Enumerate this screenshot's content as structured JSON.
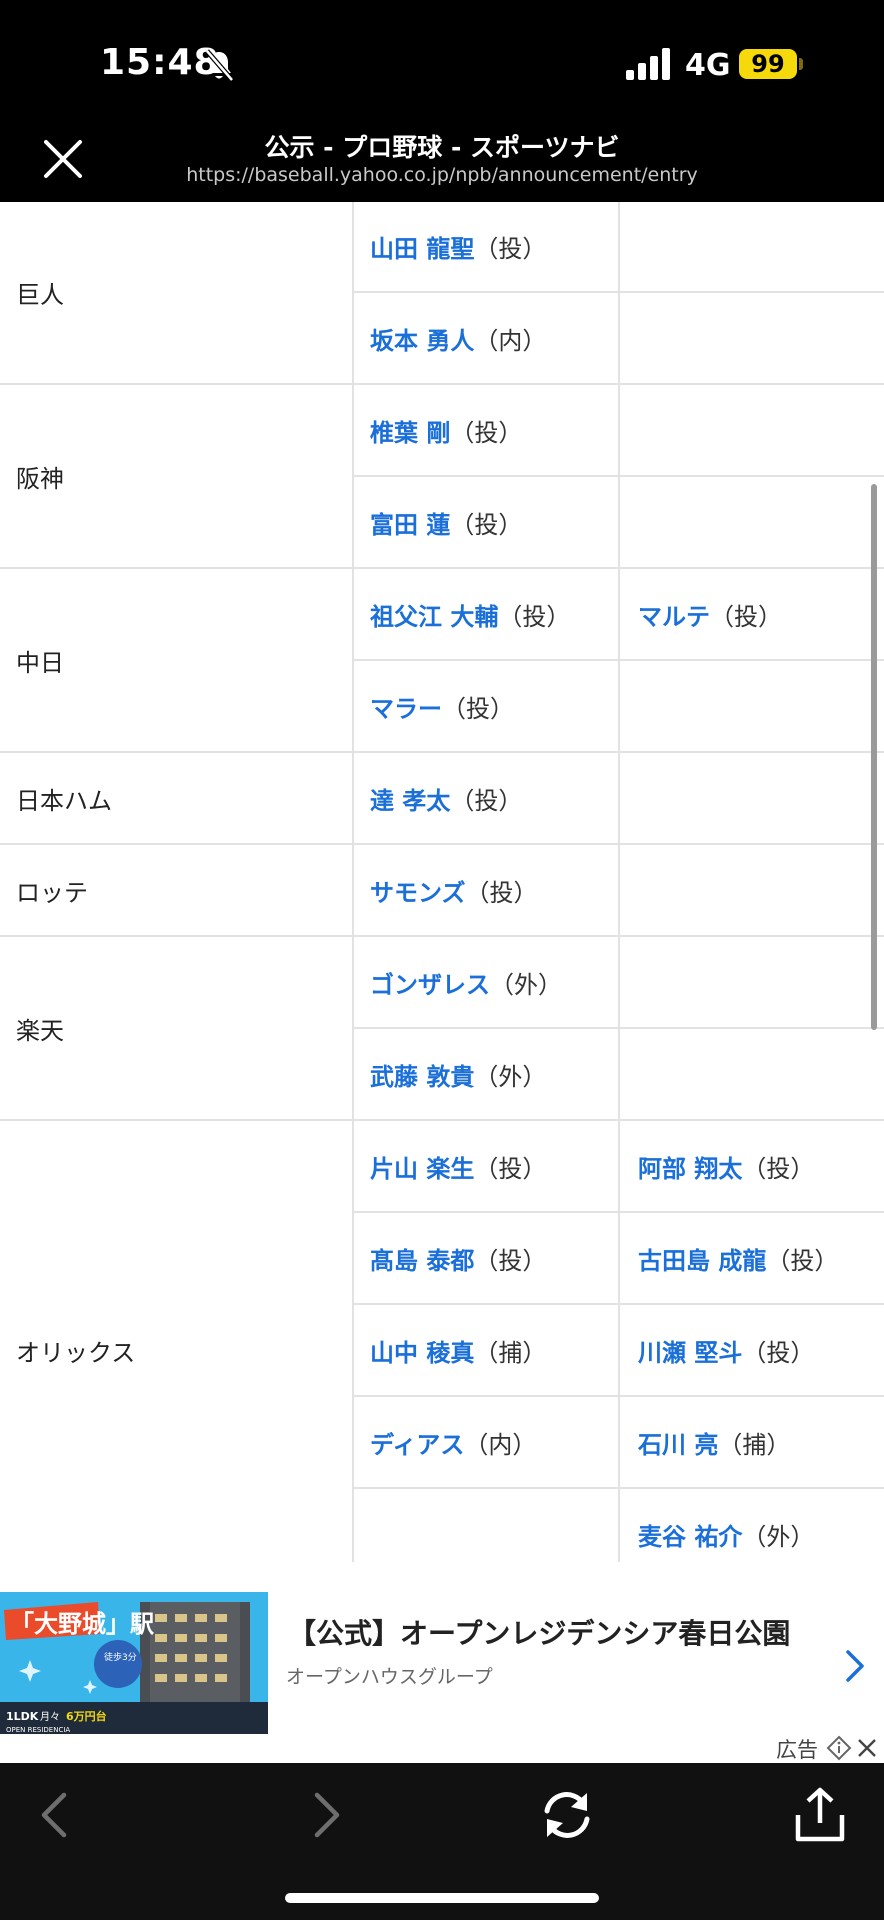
{
  "status_bar": {
    "time": "15:48",
    "network": "4G",
    "battery": "99"
  },
  "browser": {
    "title": "公示 - プロ野球 - スポーツナビ",
    "url": "https://baseball.yahoo.co.jp/npb/announcement/entry"
  },
  "roster": {
    "rows": [
      {
        "team": "巨人",
        "p1_name": "山田 龍聖",
        "p1_pos": "（投）",
        "p2_name": "",
        "p2_pos": ""
      },
      {
        "team": "",
        "p1_name": "坂本 勇人",
        "p1_pos": "（内）",
        "p2_name": "",
        "p2_pos": ""
      },
      {
        "team": "阪神",
        "p1_name": "椎葉 剛",
        "p1_pos": "（投）",
        "p2_name": "",
        "p2_pos": ""
      },
      {
        "team": "",
        "p1_name": "富田 蓮",
        "p1_pos": "（投）",
        "p2_name": "",
        "p2_pos": ""
      },
      {
        "team": "中日",
        "p1_name": "祖父江 大輔",
        "p1_pos": "（投）",
        "p2_name": "マルテ",
        "p2_pos": "（投）"
      },
      {
        "team": "",
        "p1_name": "マラー",
        "p1_pos": "（投）",
        "p2_name": "",
        "p2_pos": ""
      },
      {
        "team": "日本ハム",
        "p1_name": "達 孝太",
        "p1_pos": "（投）",
        "p2_name": "",
        "p2_pos": ""
      },
      {
        "team": "ロッテ",
        "p1_name": "サモンズ",
        "p1_pos": "（投）",
        "p2_name": "",
        "p2_pos": ""
      },
      {
        "team": "楽天",
        "p1_name": "ゴンザレス",
        "p1_pos": "（外）",
        "p2_name": "",
        "p2_pos": ""
      },
      {
        "team": "",
        "p1_name": "武藤 敦貴",
        "p1_pos": "（外）",
        "p2_name": "",
        "p2_pos": ""
      },
      {
        "team": "オリックス",
        "p1_name": "片山 楽生",
        "p1_pos": "（投）",
        "p2_name": "阿部 翔太",
        "p2_pos": "（投）"
      },
      {
        "team": "",
        "p1_name": "髙島 泰都",
        "p1_pos": "（投）",
        "p2_name": "古田島 成龍",
        "p2_pos": "（投）"
      },
      {
        "team": "",
        "p1_name": "山中 稜真",
        "p1_pos": "（捕）",
        "p2_name": "川瀬 堅斗",
        "p2_pos": "（投）"
      },
      {
        "team": "",
        "p1_name": "ディアス",
        "p1_pos": "（内）",
        "p2_name": "石川 亮",
        "p2_pos": "（捕）"
      },
      {
        "team": "",
        "p1_name": "",
        "p1_pos": "",
        "p2_name": "麦谷 祐介",
        "p2_pos": "（外）"
      }
    ]
  },
  "ad": {
    "title": "【公式】オープンレジデンシア春日公園",
    "subtitle": "オープンハウスグループ",
    "label": "広告",
    "image_text": {
      "station": "「大野城」駅",
      "walk": "徒歩3分",
      "layout": "1LDK",
      "price_prefix": "月々",
      "price": "6万円台",
      "brand": "OPEN RESIDENCIA"
    }
  },
  "colors": {
    "link": "#1a6fd8",
    "bar": "#000000",
    "toolbar": "#111111",
    "battery": "#f5d90a"
  }
}
